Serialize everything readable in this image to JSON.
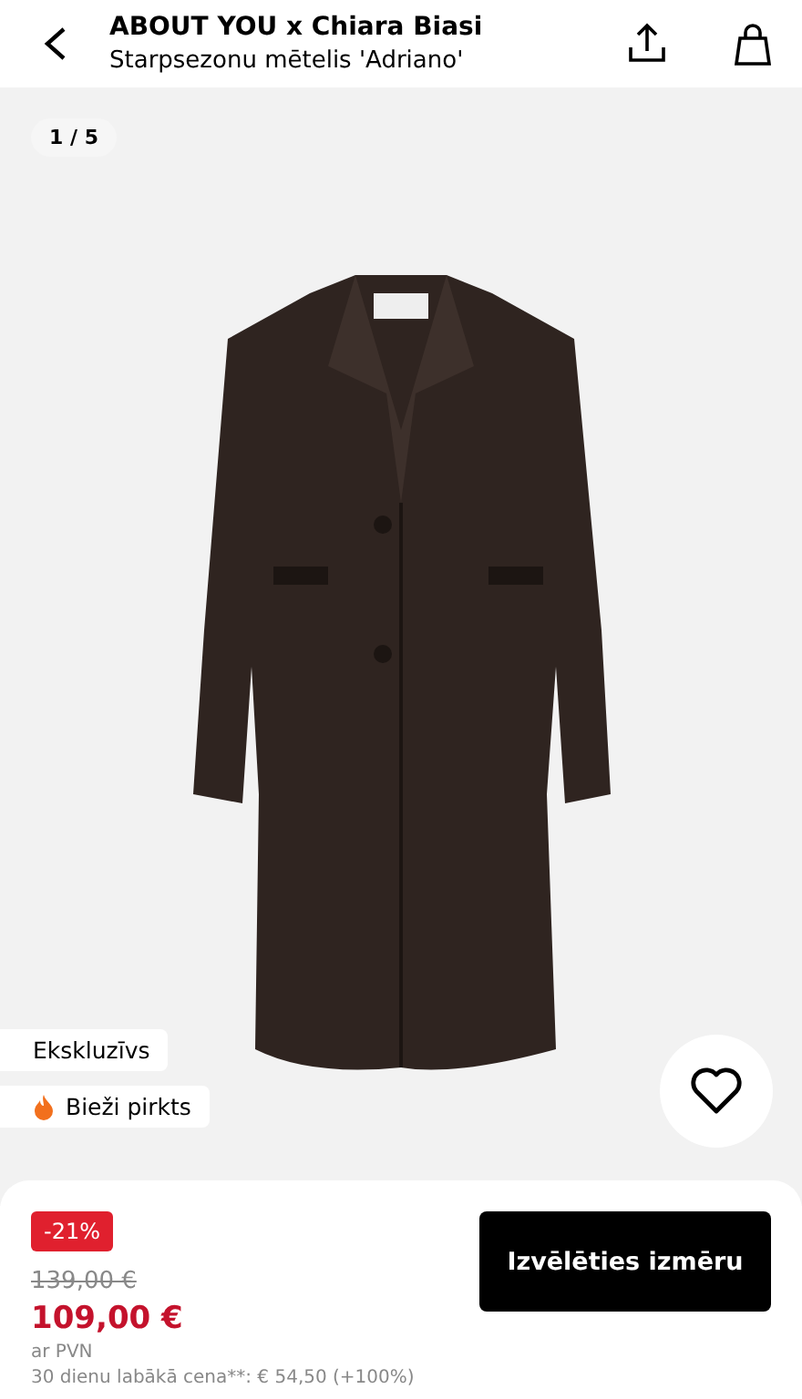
{
  "header": {
    "brand": "ABOUT YOU x Chiara Biasi",
    "product_name": "Starpsezonu mētelis 'Adriano'"
  },
  "gallery": {
    "counter": "1 / 5",
    "labels": [
      {
        "kind": "plain",
        "text": "Ekskluzīvs"
      },
      {
        "kind": "hot",
        "text": "Bieži pirkts"
      }
    ],
    "favorite": false
  },
  "purchase": {
    "discount": "-21%",
    "old_price": "139,00 €",
    "price": "109,00 €",
    "tax_note": "ar PVN",
    "lowest_price_note": "30 dienu labākā cena**: € 54,50 (+100%)",
    "button": "Izvēlēties izmēru"
  }
}
